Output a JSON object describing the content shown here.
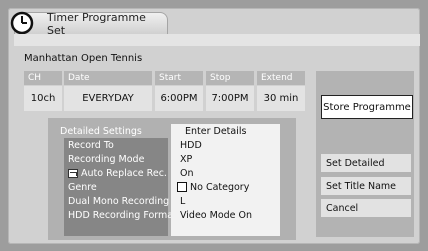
{
  "window": {
    "title": "Timer Programme Set"
  },
  "programme": {
    "name": "Manhattan Open Tennis"
  },
  "schedule": {
    "columns": [
      {
        "header": "CH",
        "value": "10ch"
      },
      {
        "header": "Date",
        "value": "EVERYDAY"
      },
      {
        "header": "Start",
        "value": "6:00PM"
      },
      {
        "header": "Stop",
        "value": "7:00PM"
      },
      {
        "header": "Extend",
        "value": "30 min"
      }
    ]
  },
  "details": {
    "header_label": "Detailed Settings",
    "header_value": "Enter Details",
    "rows": [
      {
        "label": "Record To",
        "value": "HDD"
      },
      {
        "label": "Recording Mode",
        "value": "XP"
      },
      {
        "label": "Auto Replace Rec.",
        "value": "On"
      },
      {
        "label": "Genre",
        "value": "No Category"
      },
      {
        "label": "Dual Mono Recording",
        "value": "L"
      },
      {
        "label": "HDD Recording Format",
        "value": "Video Mode On"
      }
    ]
  },
  "menu": {
    "store": "Store Programme",
    "set_detailed": "Set Detailed",
    "set_title_name": "Set Title Name",
    "cancel": "Cancel"
  },
  "icons": {
    "title": "timer-clock-icon",
    "auto_replace": "replace-icon",
    "genre_checkbox": "checkbox-icon"
  }
}
